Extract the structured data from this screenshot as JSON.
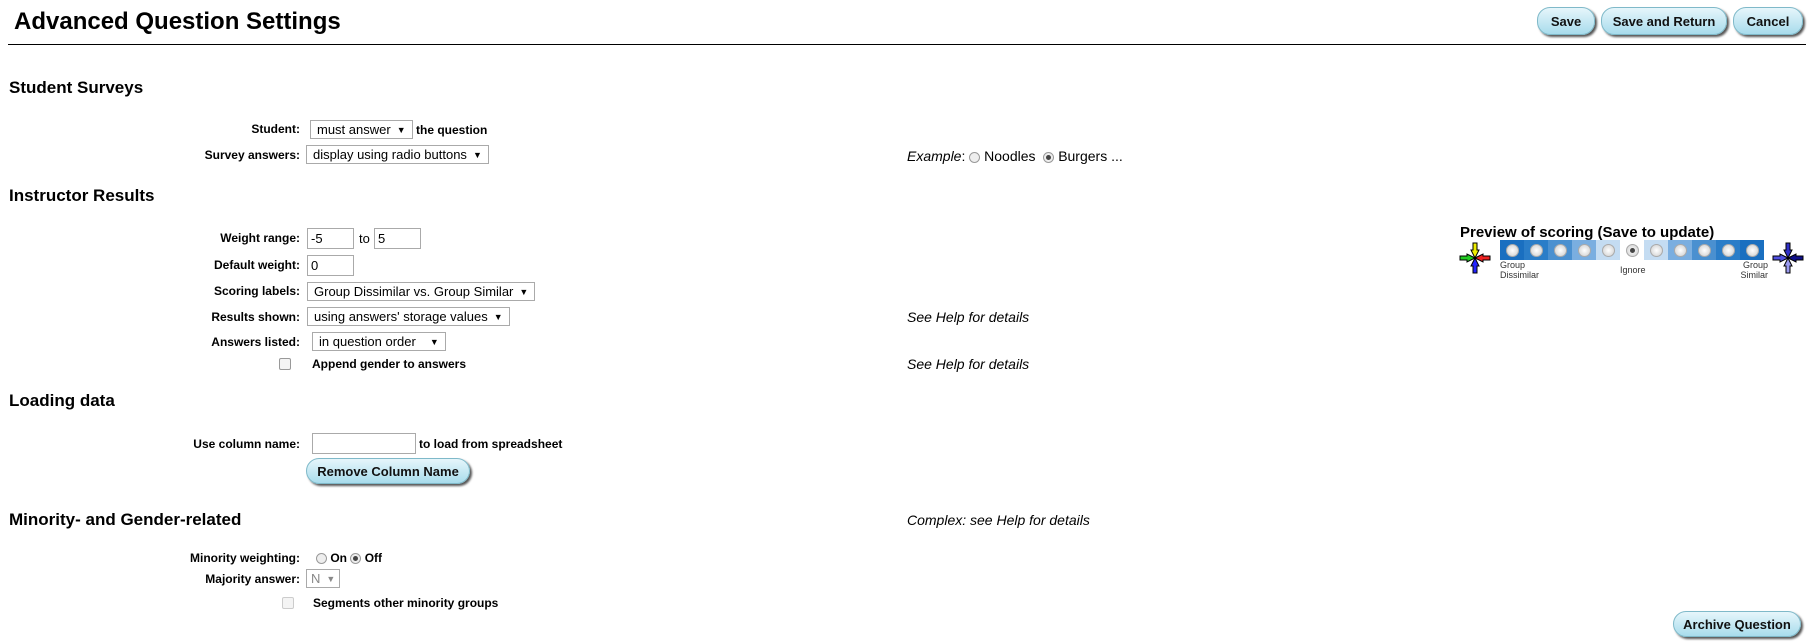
{
  "header": {
    "title": "Advanced Question Settings",
    "save": "Save",
    "save_return": "Save and Return",
    "cancel": "Cancel"
  },
  "student_surveys": {
    "heading": "Student Surveys",
    "student_label": "Student:",
    "student_value": "must answer",
    "student_suffix": "the question",
    "survey_label": "Survey answers:",
    "survey_value": "display using radio buttons",
    "example_label": "Example",
    "example_opt1": "Noodles",
    "example_opt2": "Burgers ...",
    "example_selected": "Burgers"
  },
  "instructor": {
    "heading": "Instructor Results",
    "weight_label": "Weight range:",
    "weight_min": "-5",
    "weight_to": "to",
    "weight_max": "5",
    "default_label": "Default weight:",
    "default_value": "0",
    "scoring_label": "Scoring labels:",
    "scoring_value": "Group Dissimilar vs. Group Similar",
    "results_label": "Results shown:",
    "results_value": "using answers' storage values",
    "results_help": "See Help for details",
    "answers_label": "Answers listed:",
    "answers_value": "in question order",
    "append_label": "Append gender to answers",
    "append_checked": false,
    "append_help": "See Help for details",
    "preview": {
      "title": "Preview of scoring (Save to update)",
      "left_label": "Group Dissimilar",
      "mid_label": "Ignore",
      "right_label": "Group Similar",
      "selected_index": 5,
      "cell_colors": [
        "#1a6fc0",
        "#2a7dc8",
        "#4a90d0",
        "#7aaee0",
        "#c4dcf2",
        "#ffffff",
        "#c4dcf2",
        "#7aaee0",
        "#4a90d0",
        "#2a7dc8",
        "#1a6fc0"
      ]
    }
  },
  "loading": {
    "heading": "Loading data",
    "col_label": "Use column name:",
    "col_value": "",
    "col_suffix": "to load from spreadsheet",
    "remove": "Remove Column Name"
  },
  "minority": {
    "heading": "Minority- and Gender-related",
    "help": "Complex: see Help for details",
    "weighting_label": "Minority weighting:",
    "on": "On",
    "off": "Off",
    "weighting_selected": "Off",
    "majority_label": "Majority answer:",
    "majority_value": "N",
    "segments_label": "Segments other minority groups",
    "segments_checked": false
  },
  "archive": "Archive Question"
}
